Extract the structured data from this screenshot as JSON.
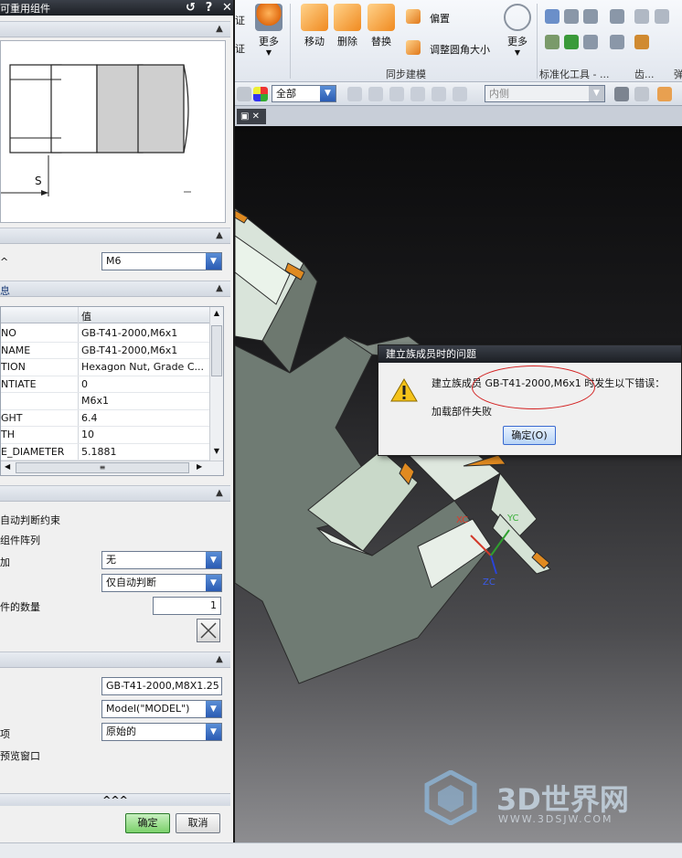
{
  "dialog": {
    "title": "可重用组件",
    "title_buttons": [
      "↺",
      "?",
      "✕"
    ],
    "preview_dim_label": "S",
    "size_combo": "M6",
    "table": {
      "headers": [
        "",
        "值"
      ],
      "rows": [
        [
          "NO",
          "GB-T41-2000,M6x1"
        ],
        [
          "NAME",
          "GB-T41-2000,M6x1"
        ],
        [
          "TION",
          "Hexagon Nut, Grade C..."
        ],
        [
          "NTIATE",
          "0"
        ],
        [
          "",
          "M6x1"
        ],
        [
          "GHT",
          "6.4"
        ],
        [
          "TH",
          "10"
        ],
        [
          "E_DIAMETER",
          "5.1881"
        ]
      ]
    },
    "placement": {
      "auto_constraint_label": "自动判断约束",
      "array_label": "组件阵列",
      "add_label": "加",
      "add_combo": "无",
      "constraint_combo": "仅自动判断",
      "count_label": "件的数量",
      "count_value": "1"
    },
    "settings": {
      "name_value": "GB-T41-2000,M8X1.25",
      "refset_combo": "Model(\"MODEL\")",
      "layer_label": "项",
      "layer_combo": "原始的",
      "preview_window_label": "预览窗口"
    },
    "more_label": "^^^",
    "ok_label": "确定",
    "cancel_label": "取消"
  },
  "ribbon": {
    "left_partial_labels": [
      "证",
      "证"
    ],
    "more_label": "更多",
    "move_label": "移动",
    "delete_label": "删除",
    "replace_label": "替换",
    "offset_label": "偏置",
    "resize_blend_label": "调整圆角大小",
    "more2_label": "更多",
    "group_label": "同步建模",
    "std_tools_label": "标准化工具 - ...",
    "gear_label": "齿...",
    "bounce_label": "弹"
  },
  "toolbar2": {
    "filter_combo": "全部",
    "side_combo": "内侧"
  },
  "error_dialog": {
    "title": "建立族成员时的问题",
    "message_line1": "建立族成员 GB-T41-2000,M6x1 时发生以下错误：",
    "message_line2": "加载部件失败",
    "ok_label": "确定(O)"
  },
  "axes": {
    "xc": "XC",
    "yc": "YC",
    "zc": "ZC"
  },
  "watermark": {
    "brand": "3D世界网",
    "url": "WWW.3DSJW.COM"
  },
  "colors": {
    "accent_blue": "#2a5bb3",
    "error_circle": "#d32020",
    "part_face": "#6f7b73"
  }
}
